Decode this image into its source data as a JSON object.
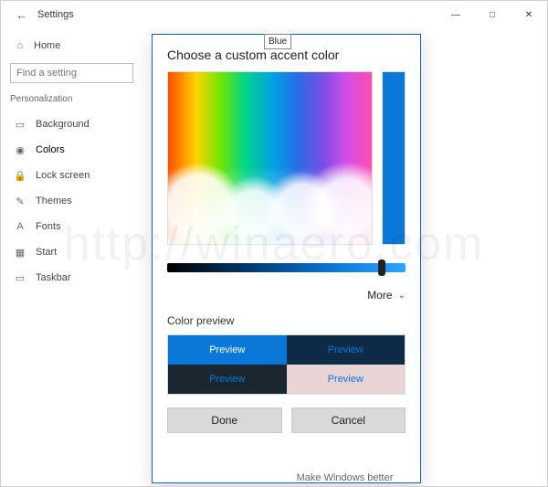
{
  "window": {
    "title": "Settings",
    "controls": {
      "min": "—",
      "max": "□",
      "close": "✕"
    },
    "back_icon": "←"
  },
  "sidebar": {
    "home_label": "Home",
    "home_icon": "⌂",
    "search_placeholder": "Find a setting",
    "category": "Personalization",
    "items": [
      {
        "icon": "▭",
        "label": "Background"
      },
      {
        "icon": "◉",
        "label": "Colors"
      },
      {
        "icon": "🔒",
        "label": "Lock screen"
      },
      {
        "icon": "✎",
        "label": "Themes"
      },
      {
        "icon": "A",
        "label": "Fonts"
      },
      {
        "icon": "▦",
        "label": "Start"
      },
      {
        "icon": "▭",
        "label": "Taskbar"
      }
    ]
  },
  "dialog": {
    "title": "Choose a custom accent color",
    "tooltip": "Blue",
    "more_label": "More",
    "preview_label": "Color preview",
    "preview_text": "Preview",
    "done_label": "Done",
    "cancel_label": "Cancel",
    "selected_color": "#0a78d8"
  },
  "footer": "Make Windows better"
}
